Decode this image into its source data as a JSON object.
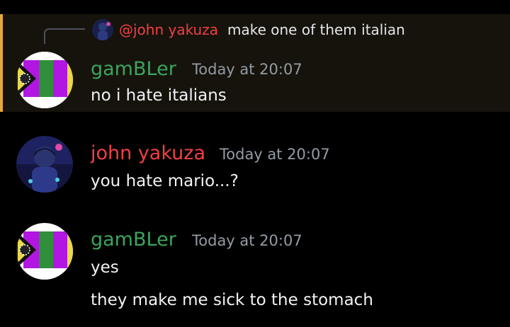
{
  "reply": {
    "mention": "@john yakuza",
    "text": "make one of them italian"
  },
  "messages": [
    {
      "author": "gamBLer",
      "author_color": "#3ba55c",
      "timestamp": "Today at 20:07",
      "avatar_caption": "bling Pride",
      "lines": [
        "no i hate italians"
      ],
      "highlighted": true
    },
    {
      "author": "john yakuza",
      "author_color": "#f23f42",
      "timestamp": "Today at 20:07",
      "lines": [
        "you hate mario...?"
      ]
    },
    {
      "author": "gamBLer",
      "author_color": "#3ba55c",
      "timestamp": "Today at 20:07",
      "avatar_caption": "bling Pride",
      "lines": [
        "yes",
        "they make me sick to the stomach"
      ]
    }
  ],
  "colors": {
    "background": "#000000",
    "highlight": "#16130c",
    "highlight_bar": "#e5a83b",
    "timestamp": "#949ba4"
  }
}
